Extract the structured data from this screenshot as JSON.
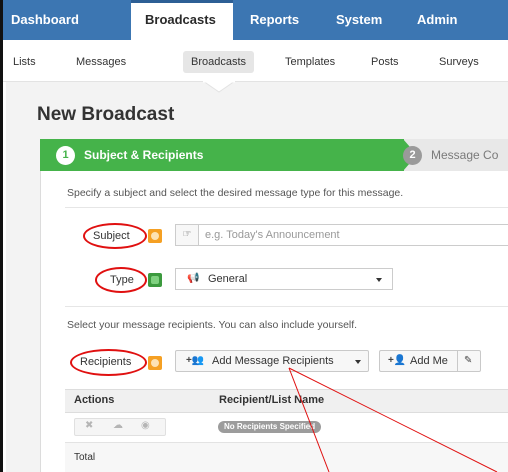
{
  "top_nav": {
    "items": [
      {
        "label": "Dashboard",
        "active": false
      },
      {
        "label": "Broadcasts",
        "active": true
      },
      {
        "label": "Reports",
        "active": false
      },
      {
        "label": "System",
        "active": false
      },
      {
        "label": "Admin",
        "active": false
      }
    ]
  },
  "sub_nav": {
    "items": [
      {
        "label": "Lists",
        "active": false
      },
      {
        "label": "Messages",
        "active": false
      },
      {
        "label": "Broadcasts",
        "active": true
      },
      {
        "label": "Templates",
        "active": false
      },
      {
        "label": "Posts",
        "active": false
      },
      {
        "label": "Surveys",
        "active": false
      }
    ]
  },
  "page": {
    "title": "New Broadcast"
  },
  "wizard": {
    "steps": [
      {
        "number": "1",
        "label": "Subject & Recipients",
        "active": true
      },
      {
        "number": "2",
        "label": "Message Co",
        "active": false
      }
    ]
  },
  "form": {
    "subject_help": "Specify a subject and select the desired message type for this message.",
    "subject_label": "Subject",
    "subject_placeholder": "e.g. Today's Announcement",
    "subject_value": "",
    "type_label": "Type",
    "type_value": "General",
    "recipients_help": "Select your message recipients. You can also include yourself.",
    "recipients_label": "Recipients",
    "add_recipients_label": "Add Message Recipients",
    "add_me_label": "Add Me"
  },
  "recipients_table": {
    "columns": [
      "Actions",
      "Recipient/List Name"
    ],
    "empty_badge": "No Recipients Specified",
    "total_label": "Total"
  },
  "colors": {
    "top_nav_bg": "#3c76b2",
    "wizard_active": "#45b34a",
    "annotation": "#e01010",
    "required_badge": "#f5a023"
  },
  "icons": {
    "subject_addon": "hand-pointer-icon",
    "type_addon": "megaphone-icon",
    "add_recipients": "users-add-icon",
    "add_me": "user-add-icon",
    "edit": "pencil-icon",
    "row_delete": "close-icon",
    "row_upload": "cloud-icon",
    "row_view": "eye-icon"
  }
}
